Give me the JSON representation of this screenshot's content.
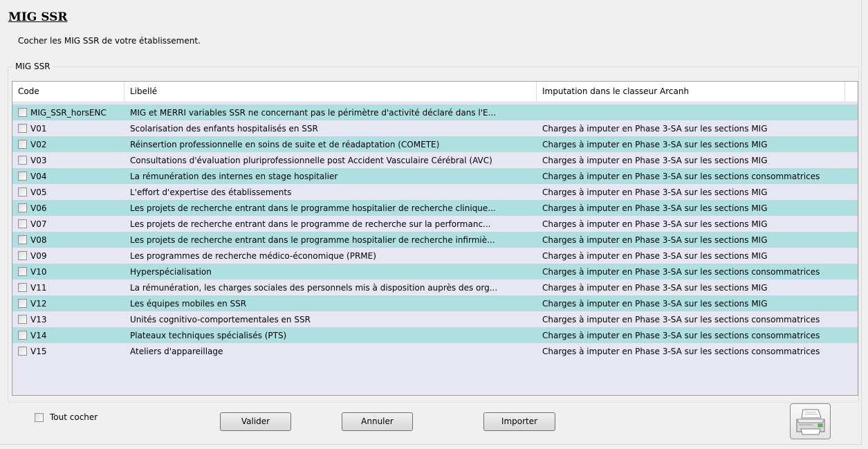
{
  "header": {
    "title": "MIG SSR",
    "subtitle": "Cocher les MIG SSR de votre établissement."
  },
  "group": {
    "legend": "MIG SSR"
  },
  "table": {
    "columns": [
      "Code",
      "Libellé",
      "Imputation dans le classeur Arcanh"
    ],
    "rows": [
      {
        "code": "MIG_SSR_horsENC",
        "libelle": "MIG et MERRI variables SSR ne concernant pas le périmètre d'activité déclaré dans l'E...",
        "imputation": ""
      },
      {
        "code": "V01",
        "libelle": "Scolarisation des enfants hospitalisés en SSR",
        "imputation": "Charges à imputer en Phase 3-SA sur les sections MIG"
      },
      {
        "code": "V02",
        "libelle": "Réinsertion professionnelle en soins de suite et de réadaptation (COMETE)",
        "imputation": "Charges à imputer en Phase 3-SA sur les sections MIG"
      },
      {
        "code": "V03",
        "libelle": "Consultations d'évaluation pluriprofessionnelle post Accident Vasculaire Cérébral (AVC)",
        "imputation": "Charges à imputer en Phase 3-SA sur les sections MIG"
      },
      {
        "code": "V04",
        "libelle": "La rémunération des internes en stage hospitalier",
        "imputation": "Charges à imputer en Phase 3-SA sur les sections consommatrices"
      },
      {
        "code": "V05",
        "libelle": "L'effort d'expertise des établissements",
        "imputation": "Charges à imputer en Phase 3-SA sur les sections MIG"
      },
      {
        "code": "V06",
        "libelle": "Les projets de recherche entrant dans le programme hospitalier de recherche clinique...",
        "imputation": "Charges à imputer en Phase 3-SA sur les sections MIG"
      },
      {
        "code": "V07",
        "libelle": "Les projets de recherche entrant dans le programme de recherche sur la performanc...",
        "imputation": "Charges à imputer en Phase 3-SA sur les sections MIG"
      },
      {
        "code": "V08",
        "libelle": "Les projets de recherche entrant dans le programme hospitalier de recherche infirmiè...",
        "imputation": "Charges à imputer en Phase 3-SA sur les sections MIG"
      },
      {
        "code": "V09",
        "libelle": "Les programmes de recherche médico-économique (PRME)",
        "imputation": "Charges à imputer en Phase 3-SA sur les sections MIG"
      },
      {
        "code": "V10",
        "libelle": "Hyperspécialisation",
        "imputation": "Charges à imputer en Phase 3-SA sur les sections consommatrices"
      },
      {
        "code": "V11",
        "libelle": "La rémunération, les charges sociales des personnels mis à disposition auprès des org...",
        "imputation": "Charges à imputer en Phase 3-SA sur les sections MIG"
      },
      {
        "code": "V12",
        "libelle": "Les équipes mobiles en SSR",
        "imputation": "Charges à imputer en Phase 3-SA sur les sections MIG"
      },
      {
        "code": "V13",
        "libelle": "Unités cognitivo-comportementales en SSR",
        "imputation": "Charges à imputer en Phase 3-SA sur les sections consommatrices"
      },
      {
        "code": "V14",
        "libelle": "Plateaux techniques spécialisés (PTS)",
        "imputation": "Charges à imputer en Phase 3-SA sur les sections consommatrices"
      },
      {
        "code": "V15",
        "libelle": "Ateliers d'appareillage",
        "imputation": "Charges à imputer en Phase 3-SA sur les sections consommatrices"
      }
    ]
  },
  "footer": {
    "select_all_label": "Tout cocher",
    "validate_label": "Valider",
    "cancel_label": "Annuler",
    "import_label": "Importer",
    "print_icon": "printer-icon"
  },
  "colors": {
    "row_alt": "#aee0e2",
    "table_bg": "#e7e7f4"
  }
}
